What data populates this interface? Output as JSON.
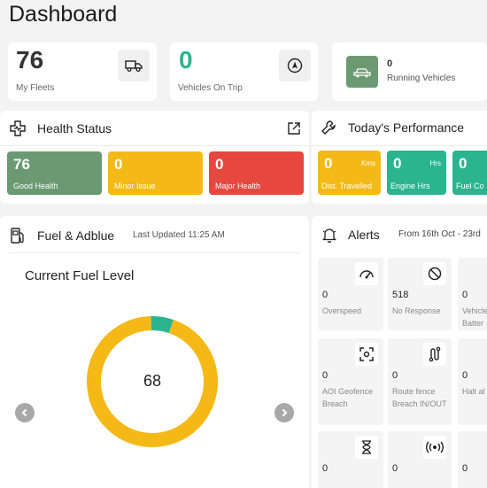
{
  "page": {
    "title": "Dashboard"
  },
  "kpis": {
    "fleets": {
      "value": "76",
      "label": "My Fleets",
      "icon": "truck-icon"
    },
    "on_trip": {
      "value": "0",
      "label": "Vehicles On Trip",
      "icon": "navigation-icon"
    },
    "running": {
      "value": "0",
      "label": "Running Vehicles",
      "icon": "car-icon"
    }
  },
  "health": {
    "title": "Health Status",
    "tiles": [
      {
        "value": "76",
        "label": "Good Health",
        "color": "#6b9a72"
      },
      {
        "value": "0",
        "label": "Minor Issue",
        "color": "#f4b916"
      },
      {
        "value": "0",
        "label": "Major Health",
        "color": "#e64840"
      }
    ]
  },
  "performance": {
    "title": "Today's Performance",
    "tiles": [
      {
        "value": "0",
        "unit": "Kms",
        "label": "Dist. Travelled",
        "color": "#f4b916"
      },
      {
        "value": "0",
        "unit": "Hrs",
        "label": "Engine Hrs",
        "color": "#2bb58f"
      },
      {
        "value": "0",
        "label": "Fuel Co",
        "color": "#2bb58f"
      }
    ]
  },
  "fuel": {
    "title": "Fuel & Adblue",
    "updated": "Last Updated 11:25 AM",
    "chart_title": "Current Fuel Level",
    "center_value": "68"
  },
  "chart_data": {
    "type": "pie",
    "title": "Current Fuel Level",
    "values": [
      68,
      4
    ],
    "colors": [
      "#f4b916",
      "#2bb58f"
    ]
  },
  "alerts": {
    "title": "Alerts",
    "range": "From 16th Oct - 23rd",
    "items": [
      {
        "value": "0",
        "label": "Overspeed",
        "icon": "speedometer-icon"
      },
      {
        "value": "518",
        "label": "No Response",
        "icon": "no-entry-icon"
      },
      {
        "value": "0",
        "label": "Vehicle Batter"
      },
      {
        "value": "0",
        "label": "AOI Geofence Breach",
        "icon": "geofence-icon"
      },
      {
        "value": "0",
        "label": "Route fence Breach IN/OUT",
        "icon": "route-icon"
      },
      {
        "value": "0",
        "label": "Halt al"
      },
      {
        "value": "0",
        "label": "",
        "icon": "hourglass-icon"
      },
      {
        "value": "0",
        "label": "",
        "icon": "signal-icon"
      },
      {
        "value": "0",
        "label": ""
      }
    ]
  }
}
